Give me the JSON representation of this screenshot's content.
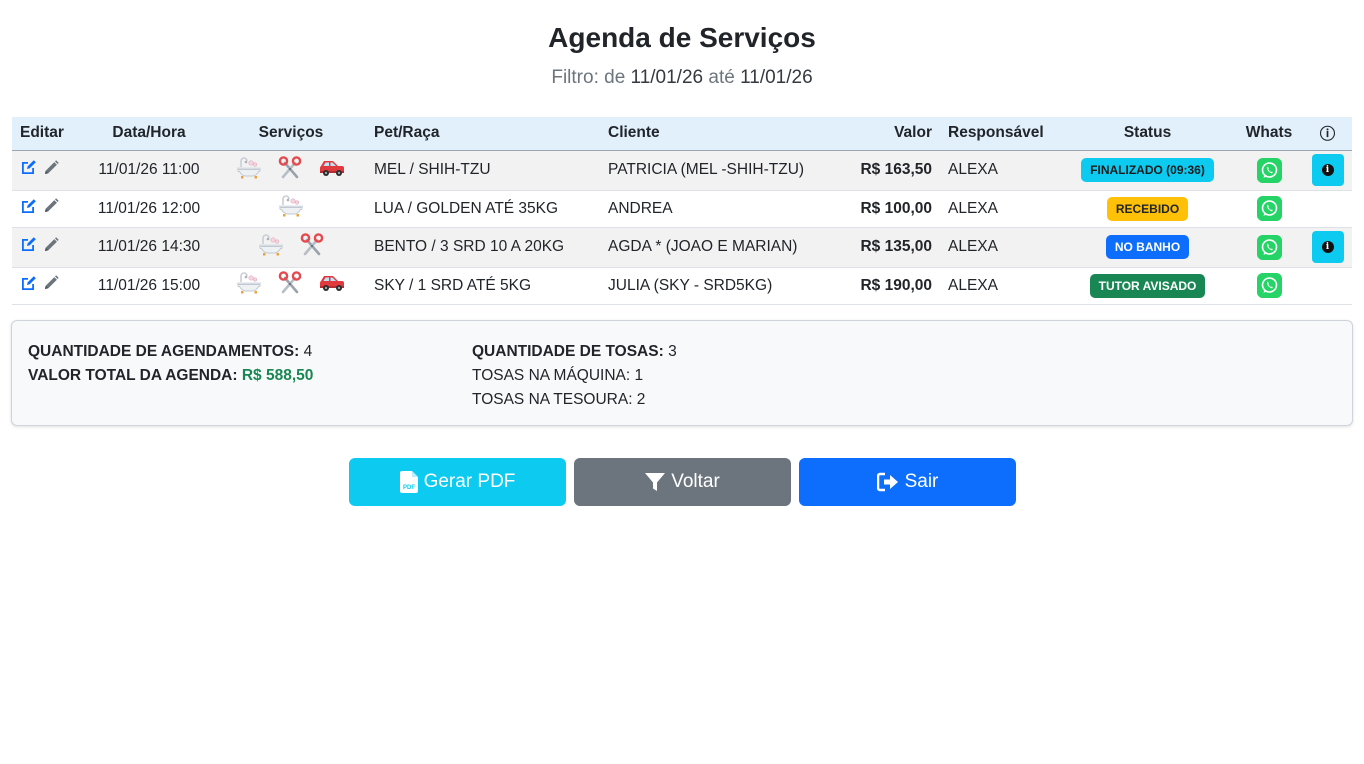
{
  "header": {
    "title": "Agenda de Serviços",
    "filter_prefix": "Filtro: de",
    "date_from": "11/01/26",
    "filter_mid": "até",
    "date_to": "11/01/26"
  },
  "table": {
    "columns": [
      "Editar",
      "Data/Hora",
      "Serviços",
      "Pet/Raça",
      "Cliente",
      "Valor",
      "Responsável",
      "Status",
      "Whats",
      "ⓘ"
    ],
    "rows": [
      {
        "datetime": "11/01/26 11:00",
        "services": [
          "bath-icon",
          "scissors-icon",
          "car-icon"
        ],
        "pet": "MEL / SHIH-TZU",
        "client": "PATRICIA (MEL -SHIH-TZU)",
        "value": "R$ 163,50",
        "responsible": "ALEXA",
        "status": "FINALIZADO (09:36)",
        "status_color": "#0dcaf0",
        "has_info": true
      },
      {
        "datetime": "11/01/26 12:00",
        "services": [
          "bath-icon"
        ],
        "pet": "LUA / GOLDEN ATÉ 35KG",
        "client": "ANDREA",
        "value": "R$ 100,00",
        "responsible": "ALEXA",
        "status": "RECEBIDO",
        "status_color": "#ffc107",
        "has_info": false
      },
      {
        "datetime": "11/01/26 14:30",
        "services": [
          "bath-icon",
          "scissors-icon"
        ],
        "pet": "BENTO / 3 SRD 10 A 20KG",
        "client": "AGDA * (JOAO E MARIAN)",
        "value": "R$ 135,00",
        "responsible": "ALEXA",
        "status": "NO BANHO",
        "status_color": "#0d6efd",
        "has_info": true
      },
      {
        "datetime": "11/01/26 15:00",
        "services": [
          "bath-icon",
          "scissors-icon",
          "car-icon"
        ],
        "pet": "SKY / 1 SRD ATÉ 5KG",
        "client": "JULIA (SKY - SRD5KG)",
        "value": "R$ 190,00",
        "responsible": "ALEXA",
        "status": "TUTOR AVISADO",
        "status_color": "#198754",
        "has_info": false
      }
    ]
  },
  "summary": {
    "appointments_label": "QUANTIDADE DE AGENDAMENTOS:",
    "appointments_value": "4",
    "total_label": "VALOR TOTAL DA AGENDA:",
    "total_value": "R$ 588,50",
    "grooming_label": "QUANTIDADE DE TOSAS:",
    "grooming_value": "3",
    "machine_line": "TOSAS NA MÁQUINA: 1",
    "scissors_line": "TOSAS NA TESOURA: 2"
  },
  "buttons": {
    "pdf": "Gerar PDF",
    "back": "Voltar",
    "exit": "Sair"
  },
  "colors": {
    "info": "#0dcaf0",
    "secondary": "#6c757d",
    "primary": "#0d6efd",
    "success": "#198754",
    "warning": "#ffc107",
    "whatsapp": "#25d366"
  }
}
